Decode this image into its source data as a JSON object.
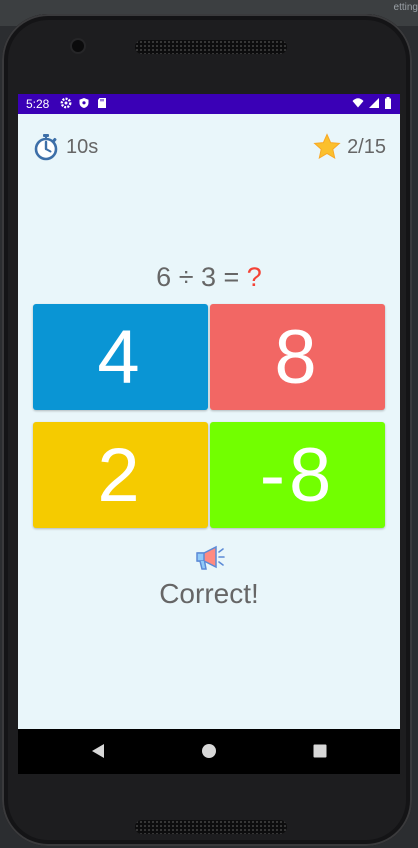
{
  "desktop": {
    "corner_hint": "etting"
  },
  "status_bar": {
    "time": "5:28",
    "left_icons": [
      "gear-icon",
      "shield-icon",
      "sd-card-icon"
    ],
    "right_icons": [
      "wifi-icon",
      "signal-icon",
      "battery-icon"
    ],
    "color": "#3a00b6"
  },
  "hud": {
    "timer": "10s",
    "score": "2/15",
    "timer_icon": "stopwatch-icon",
    "score_icon": "star-icon"
  },
  "question": {
    "expression": "6 ÷ 3 = ",
    "unknown": "?"
  },
  "answers": [
    {
      "label": "4",
      "color": "#0a95d4"
    },
    {
      "label": "8",
      "color": "#f26764"
    },
    {
      "label": "2",
      "color": "#f5cb00"
    },
    {
      "label": "-8",
      "color": "#72ff00"
    }
  ],
  "feedback": {
    "icon": "megaphone-icon",
    "text": "Correct!"
  },
  "navigation": [
    "back-icon",
    "home-icon",
    "recents-icon"
  ]
}
